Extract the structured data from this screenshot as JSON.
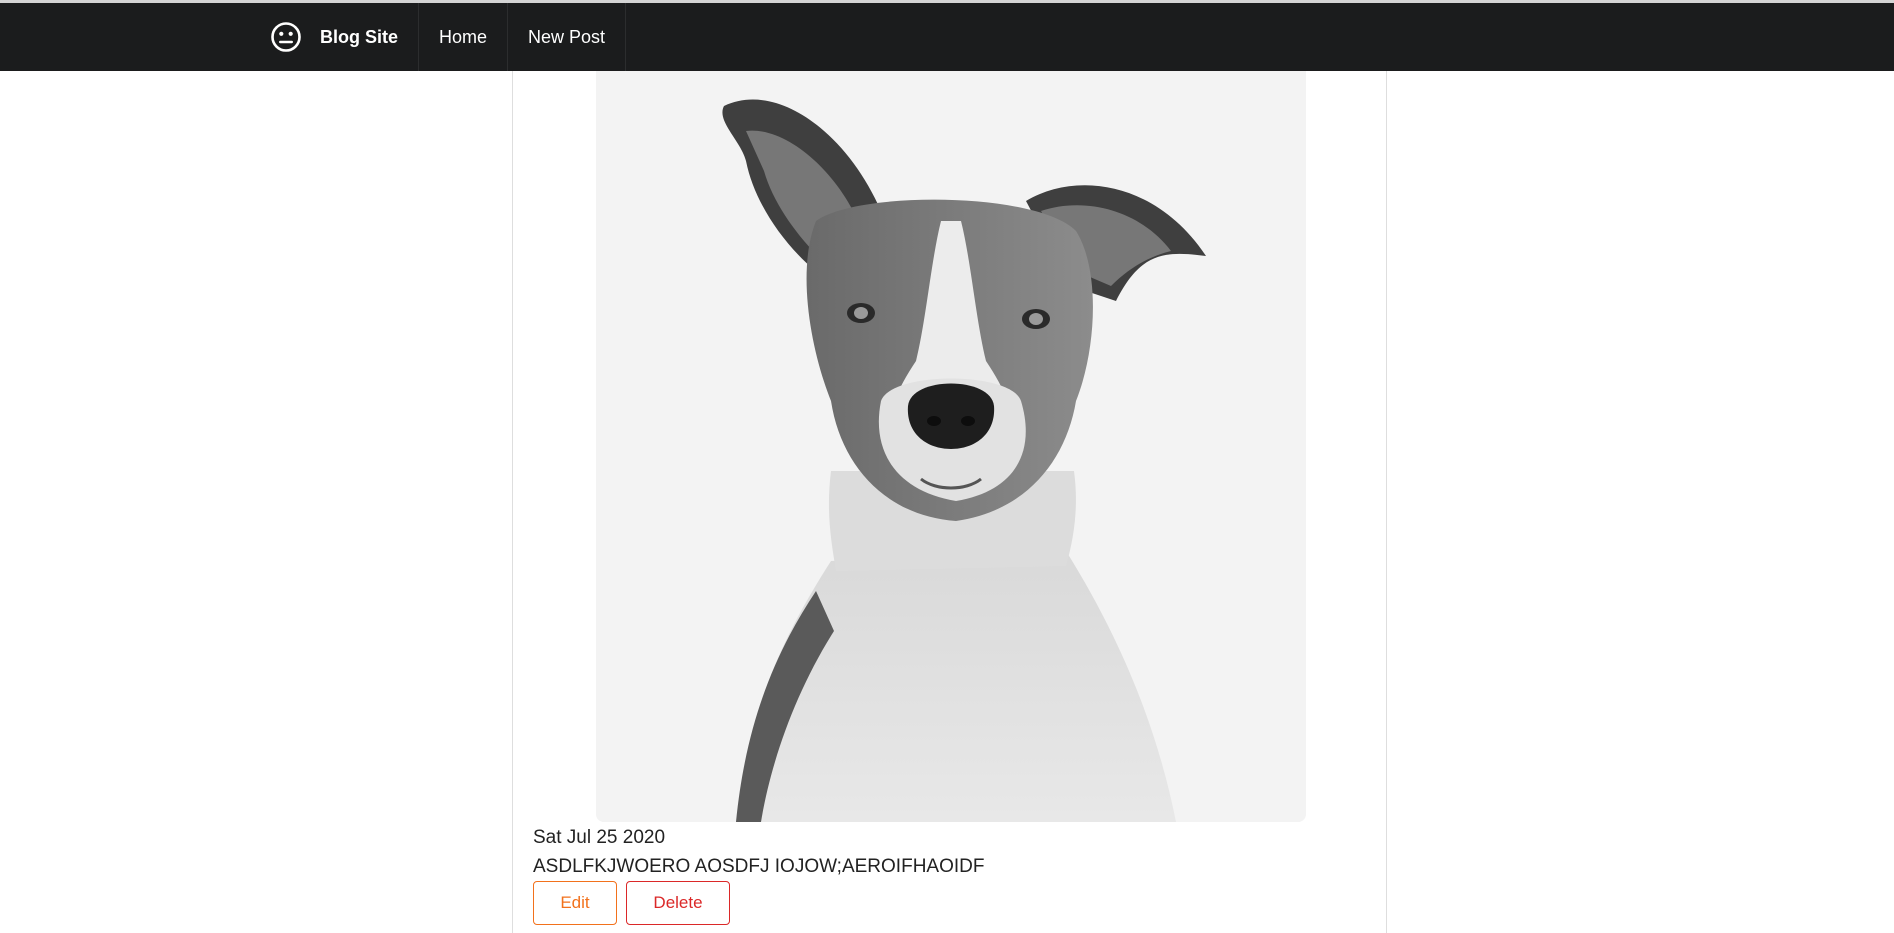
{
  "navbar": {
    "brand_icon": "neutral-face-icon",
    "brand_label": "Blog Site",
    "items": [
      {
        "label": "Home"
      },
      {
        "label": "New Post"
      }
    ]
  },
  "post": {
    "image_subject": "dog-photo",
    "date": "Sat Jul 25 2020",
    "body": "ASDLFKJWOERO AOSDFJ IOJOW;AEROIFHAOIDF",
    "edit_label": "Edit",
    "delete_label": "Delete"
  },
  "colors": {
    "navbar_bg": "#1b1c1d",
    "edit_accent": "#f2711c",
    "delete_accent": "#db2828"
  }
}
